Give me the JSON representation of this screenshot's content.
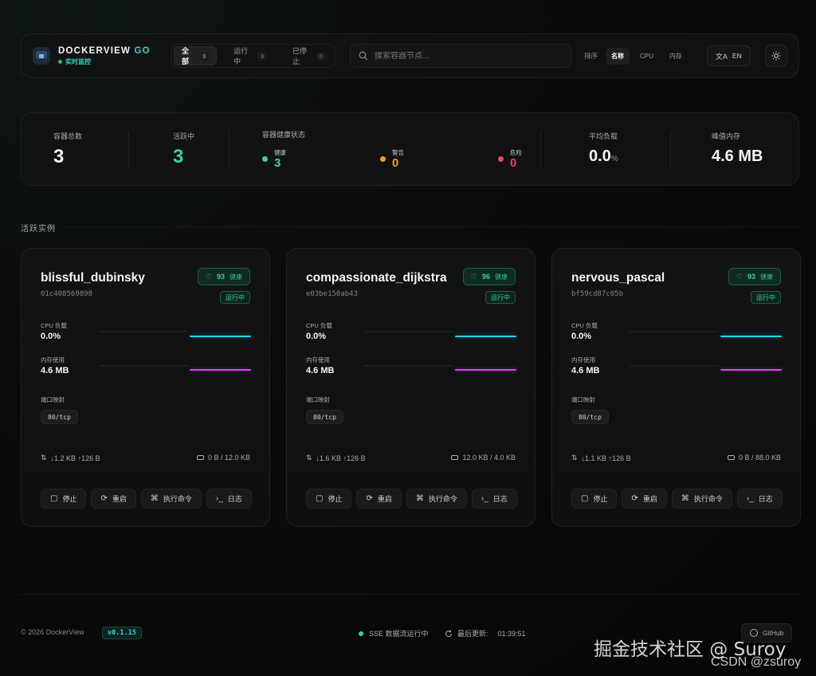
{
  "brand": {
    "title": "DOCKERVIEW",
    "title_accent": "GO",
    "live": "实时监控"
  },
  "filters": [
    {
      "label": "全部",
      "count": "3"
    },
    {
      "label": "运行中",
      "count": "3"
    },
    {
      "label": "已停止",
      "count": "0"
    }
  ],
  "search": {
    "placeholder": "搜索容器节点..."
  },
  "sort": {
    "label": "排序",
    "options": [
      "名称",
      "CPU",
      "内存"
    ],
    "active": "名称"
  },
  "lang": {
    "label": "EN"
  },
  "stats": {
    "total_label": "容器总数",
    "total_value": "3",
    "active_label": "活跃中",
    "active_value": "3",
    "health_title": "容器健康状态",
    "healthy_label": "健康",
    "healthy_value": "3",
    "warning_label": "警告",
    "warning_value": "0",
    "danger_label": "危险",
    "danger_value": "0",
    "avg_load_label": "平均负载",
    "avg_load_value": "0.0",
    "avg_load_unit": "%",
    "peak_mem_label": "峰值内存",
    "peak_mem_value": "4.6 MB"
  },
  "section": {
    "title": "活跃实例"
  },
  "card_labels": {
    "cpu": "CPU 负载",
    "mem": "内存使用",
    "ports": "端口映射",
    "stop": "停止",
    "restart": "重启",
    "exec": "执行命令",
    "logs": "日志"
  },
  "containers": [
    {
      "name": "blissful_dubinsky",
      "id": "01c408569898",
      "score": "93",
      "score_label": "健康",
      "status": "运行中",
      "cpu": "0.0%",
      "mem": "4.6 MB",
      "port": "80/tcp",
      "net": "↓1.2 KB ↑126 B",
      "disk": "0 B / 12.0 KB"
    },
    {
      "name": "compassionate_dijkstra",
      "id": "e03be150ab43",
      "score": "96",
      "score_label": "健康",
      "status": "运行中",
      "cpu": "0.0%",
      "mem": "4.6 MB",
      "port": "80/tcp",
      "net": "↓1.6 KB ↑126 B",
      "disk": "12.0 KB / 4.0 KB"
    },
    {
      "name": "nervous_pascal",
      "id": "bf59cd87c05b",
      "score": "93",
      "score_label": "健康",
      "status": "运行中",
      "cpu": "0.0%",
      "mem": "4.6 MB",
      "port": "80/tcp",
      "net": "↓1.1 KB ↑126 B",
      "disk": "0 B / 88.0 KB"
    }
  ],
  "footer": {
    "copyright": "© 2026 DockerView",
    "version": "v0.1.15",
    "sse": "SSE 数据流运行中",
    "updated_label": "最后更新:",
    "updated_time": "01:39:51",
    "github": "GitHub"
  },
  "watermark": {
    "line1": "掘金技术社区 @ Suroy",
    "line2": "CSDN @zsuroy"
  },
  "colors": {
    "accent": "#2dd4bf",
    "healthy": "#34d399",
    "warning": "#f59e0b",
    "danger": "#f43f5e",
    "cpu_line": "#22d3ee",
    "mem_line": "#d946ef"
  }
}
